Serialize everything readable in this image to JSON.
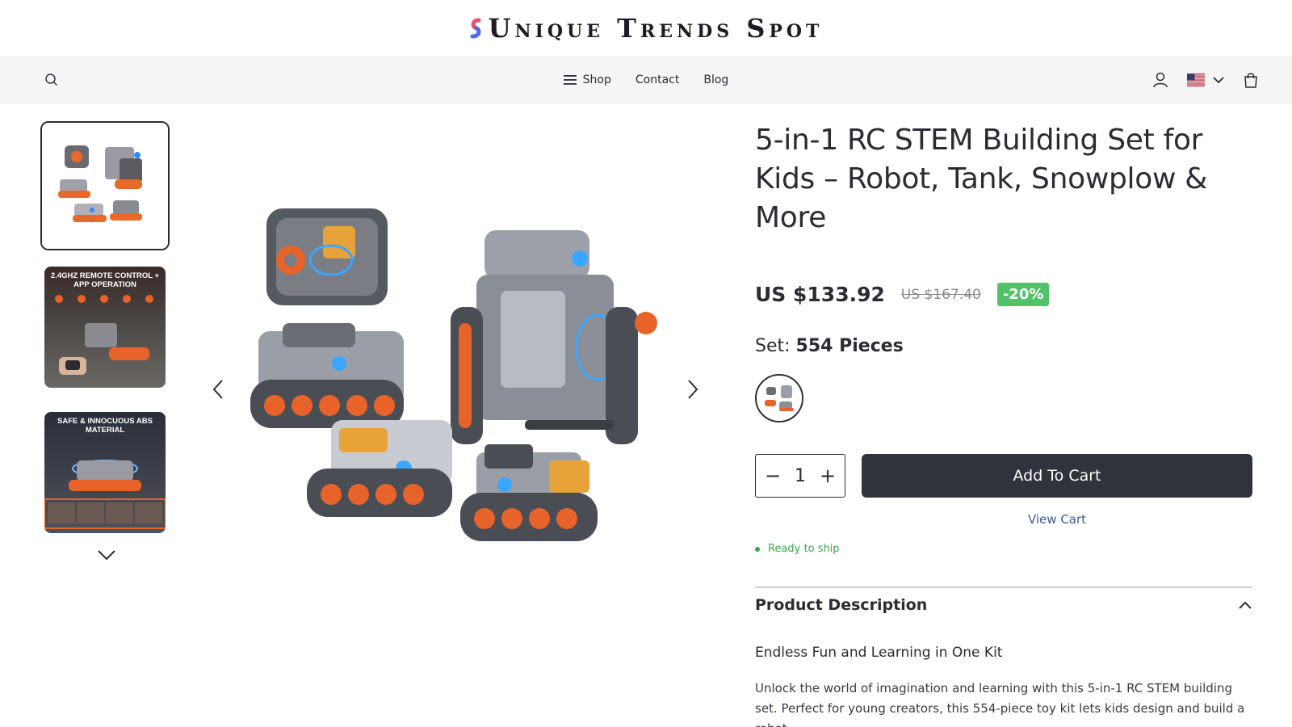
{
  "header": {
    "logo_text": "Unique Trends Spot"
  },
  "nav": {
    "links": [
      {
        "label": "Shop",
        "icon": "menu-icon"
      },
      {
        "label": "Contact"
      },
      {
        "label": "Blog"
      }
    ],
    "right_icons": [
      "account-icon",
      "us-flag-icon",
      "chevron-down-icon",
      "cart-bag-icon"
    ]
  },
  "gallery": {
    "thumbnails": [
      {
        "caption": ""
      },
      {
        "caption": "2.4GHz Remote Control + App Operation"
      },
      {
        "caption": "Safe & Innocuous ABS Material"
      }
    ]
  },
  "product": {
    "title": "5-in-1 RC STEM Building Set for Kids – Robot, Tank, Snowplow & More",
    "price": "US $133.92",
    "compare_price": "US $167.40",
    "discount_badge": "-20%",
    "option_label": "Set:",
    "option_value": "554 Pieces",
    "quantity": "1",
    "minus_label": "−",
    "plus_label": "+",
    "add_to_cart_label": "Add To Cart",
    "view_cart_label": "View Cart",
    "stock_status": "Ready to ship"
  },
  "description": {
    "heading": "Product Description",
    "subheading": "Endless Fun and Learning in One Kit",
    "body": "Unlock the world of imagination and learning with this 5-in-1 RC STEM building set. Perfect for young creators, this 554-piece toy kit lets kids design and build a robot,"
  },
  "colors": {
    "accent_dark": "#30323c",
    "discount_green": "#52c26a",
    "ready_green": "#3aa84e",
    "link_blue": "#3a5a8f",
    "nav_bg": "#f5f5f5"
  }
}
